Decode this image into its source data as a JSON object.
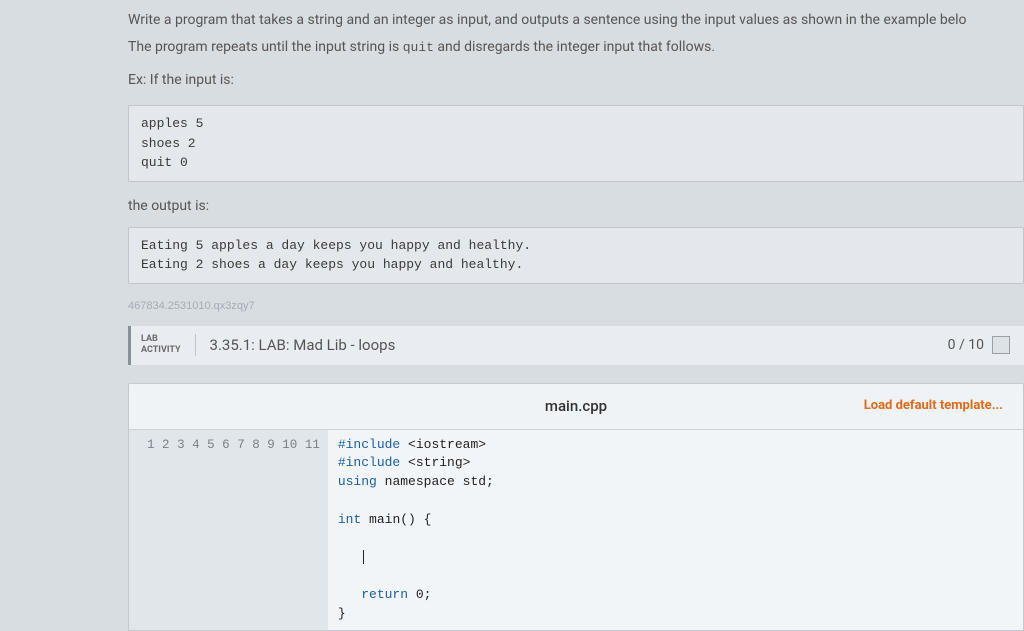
{
  "instructions": {
    "line1_a": "Write a program that takes a string and an integer as input, and outputs a sentence using the input values as shown in the example belo",
    "line2_a": "The program repeats until the input string is ",
    "line2_code": "quit",
    "line2_b": " and disregards the integer input that follows.",
    "ex_label": "Ex: If the input is:",
    "input_sample": "apples 5\nshoes 2\nquit 0",
    "output_label": "the output is:",
    "output_sample": "Eating 5 apples a day keeps you happy and healthy.\nEating 2 shoes a day keeps you happy and healthy."
  },
  "watermark": "467834.2531010.qx3zqy7",
  "lab": {
    "badge_top": "LAB",
    "badge_bottom": "ACTIVITY",
    "title": "3.35.1: LAB: Mad Lib - loops",
    "score": "0 / 10"
  },
  "editor": {
    "filename": "main.cpp",
    "load_template": "Load default template...",
    "line_numbers": [
      "1",
      "2",
      "3",
      "4",
      "5",
      "6",
      "7",
      "8",
      "9",
      "10",
      "11"
    ],
    "code": {
      "l1_a": "#include ",
      "l1_b": "<iostream>",
      "l2_a": "#include ",
      "l2_b": "<string>",
      "l3_a": "using",
      "l3_b": " namespace std;",
      "l4": "",
      "l5_a": "int",
      "l5_b": " main() {",
      "l6": "",
      "l7": "   ",
      "l8": "",
      "l9_a": "   return",
      "l9_b": " 0;",
      "l10": "}",
      "l11": ""
    }
  }
}
